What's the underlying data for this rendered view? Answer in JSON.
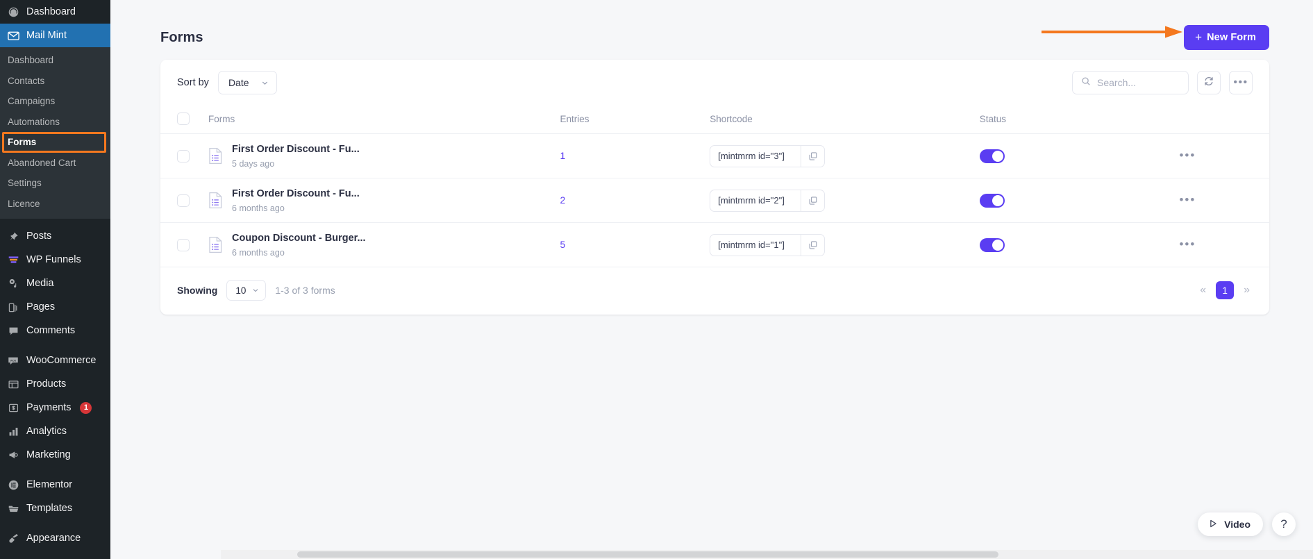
{
  "sidebar": {
    "top": [
      {
        "label": "Dashboard",
        "icon": "dashboard-icon"
      },
      {
        "label": "Mail Mint",
        "icon": "envelope-icon",
        "active": true
      }
    ],
    "submenu": [
      {
        "label": "Dashboard"
      },
      {
        "label": "Contacts"
      },
      {
        "label": "Campaigns"
      },
      {
        "label": "Automations"
      },
      {
        "label": "Forms",
        "current": true,
        "highlighted": true
      },
      {
        "label": "Abandoned Cart"
      },
      {
        "label": "Settings"
      },
      {
        "label": "Licence"
      }
    ],
    "group_two": [
      {
        "label": "Posts",
        "icon": "pin-icon"
      },
      {
        "label": "WP Funnels",
        "icon": "funnel-icon"
      },
      {
        "label": "Media",
        "icon": "media-icon"
      },
      {
        "label": "Pages",
        "icon": "pages-icon"
      },
      {
        "label": "Comments",
        "icon": "comment-icon"
      }
    ],
    "group_three": [
      {
        "label": "WooCommerce",
        "icon": "woocommerce-icon"
      },
      {
        "label": "Products",
        "icon": "products-icon"
      },
      {
        "label": "Payments",
        "icon": "payments-icon",
        "badge": "1"
      },
      {
        "label": "Analytics",
        "icon": "analytics-icon"
      },
      {
        "label": "Marketing",
        "icon": "marketing-icon"
      }
    ],
    "group_four": [
      {
        "label": "Elementor",
        "icon": "elementor-icon"
      },
      {
        "label": "Templates",
        "icon": "templates-icon"
      }
    ],
    "group_five": [
      {
        "label": "Appearance",
        "icon": "appearance-icon"
      }
    ]
  },
  "header": {
    "title": "Forms",
    "new_form_label": "New Form",
    "new_form_plus": "+"
  },
  "toolbar": {
    "sort_by_label": "Sort by",
    "sort_by_value": "Date",
    "search_placeholder": "Search...",
    "search_value": "",
    "refresh_icon": "refresh-icon",
    "more_label": "•••"
  },
  "table": {
    "columns": [
      "Forms",
      "Entries",
      "Shortcode",
      "Status"
    ],
    "rows": [
      {
        "name": "First Order Discount - Fu...",
        "date": "5 days ago",
        "entries": "1",
        "shortcode": "[mintmrm id=\"3\"]",
        "status_on": true
      },
      {
        "name": "First Order Discount - Fu...",
        "date": "6 months ago",
        "entries": "2",
        "shortcode": "[mintmrm id=\"2\"]",
        "status_on": true
      },
      {
        "name": "Coupon Discount - Burger...",
        "date": "6 months ago",
        "entries": "5",
        "shortcode": "[mintmrm id=\"1\"]",
        "status_on": true
      }
    ],
    "row_menu_label": "•••"
  },
  "footer": {
    "showing_label": "Showing",
    "per_page": "10",
    "range_text": "1-3 of 3 forms",
    "first_arrow": "«",
    "last_arrow": "»",
    "current_page": "1"
  },
  "floating": {
    "video_label": "Video",
    "help_label": "?"
  },
  "colors": {
    "accent": "#5a3df2",
    "annotation": "#f4781f",
    "sidebar_bg": "#1d2327",
    "sidebar_active": "#2271b1",
    "badge": "#d63638"
  }
}
